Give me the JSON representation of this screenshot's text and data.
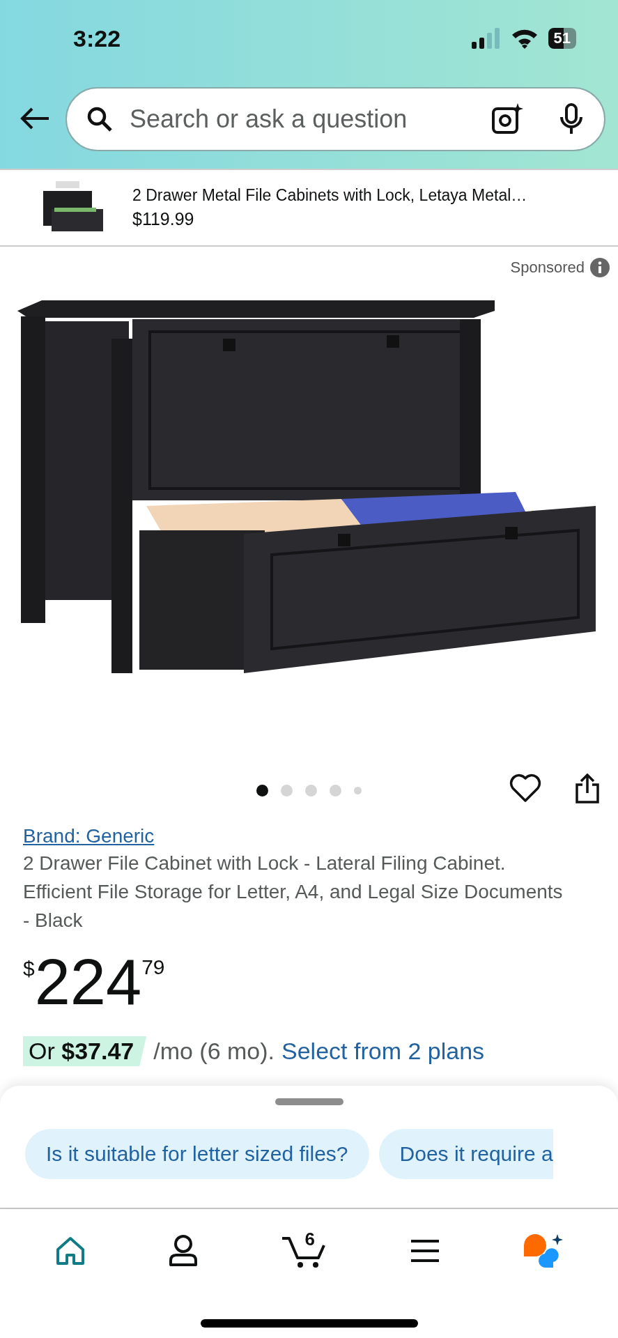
{
  "status_bar": {
    "time": "3:22",
    "battery": "51"
  },
  "search": {
    "placeholder": "Search or ask a question"
  },
  "sponsored_ad": {
    "title": "2 Drawer Metal File Cabinets with Lock, Letaya Metal…",
    "price": "$119.99"
  },
  "sponsored_label": "Sponsored",
  "image_dots": [
    {
      "selected": true
    },
    {
      "selected": false
    },
    {
      "selected": false
    },
    {
      "selected": false
    },
    {
      "selected": false
    }
  ],
  "brand_link": "Brand: Generic",
  "product_title": "2 Drawer File Cabinet with Lock - Lateral Filing Cabinet. Efficient File Storage for Letter, A4, and Legal Size Documents - Black",
  "price": {
    "currency": "$",
    "whole": "224",
    "fraction": "79"
  },
  "financing": {
    "offer": "Or **$37.47**",
    "terms": "/mo (6 mo).",
    "link": "Select from 2 plans"
  },
  "suggested_questions": [
    "Is it suitable for letter sized files?",
    "Does it require a"
  ],
  "nav": [
    {
      "kind": "home",
      "selected": true
    },
    {
      "kind": "account",
      "selected": false
    },
    {
      "kind": "cart",
      "selected": false,
      "badge": "6"
    },
    {
      "kind": "menu",
      "selected": false
    },
    {
      "kind": "assistant",
      "selected": false
    }
  ]
}
